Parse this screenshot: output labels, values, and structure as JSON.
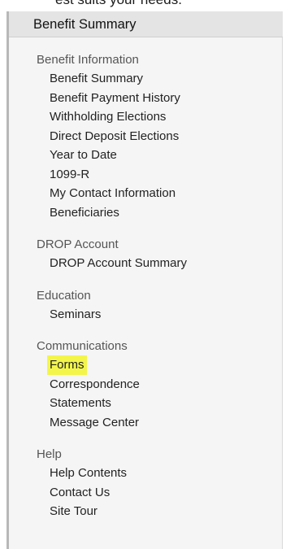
{
  "top_clipped_text": "est suits your needs.",
  "panel": {
    "title": "Benefit Summary"
  },
  "sections": [
    {
      "title": "Benefit Information",
      "items": [
        "Benefit Summary",
        "Benefit Payment History",
        "Withholding Elections",
        "Direct Deposit Elections",
        "Year to Date",
        "1099-R",
        "My Contact Information",
        "Beneficiaries"
      ]
    },
    {
      "title": "DROP Account",
      "items": [
        "DROP Account Summary"
      ]
    },
    {
      "title": "Education",
      "items": [
        "Seminars"
      ]
    },
    {
      "title": "Communications",
      "items": [
        "Forms",
        "Correspondence",
        "Statements",
        "Message Center"
      ]
    },
    {
      "title": "Help",
      "items": [
        "Help Contents",
        "Contact Us",
        "Site Tour"
      ]
    }
  ],
  "highlighted_item": "Forms",
  "colors": {
    "highlight": "#f3f54a",
    "panel_background": "#f5f5f5",
    "header_background": "#e4e4e4"
  }
}
